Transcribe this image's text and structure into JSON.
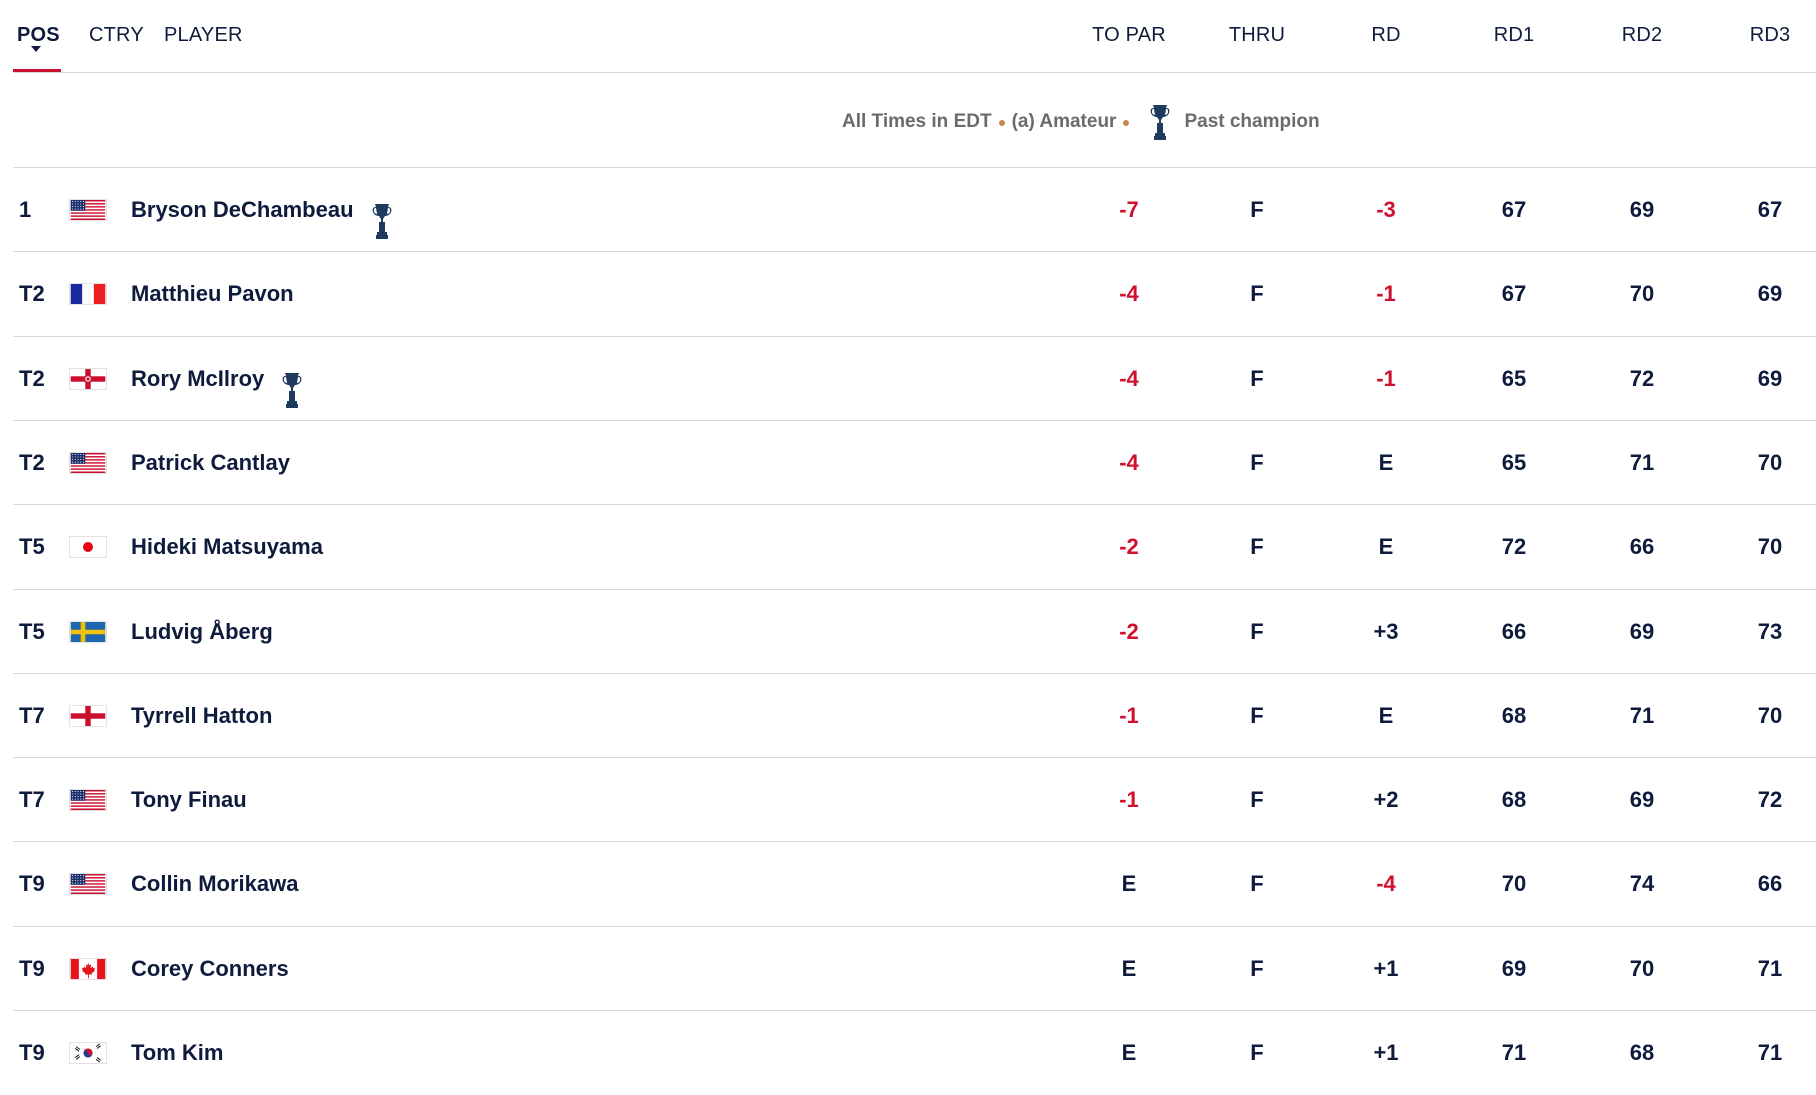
{
  "header": {
    "pos": "POS",
    "ctry": "CTRY",
    "player": "PLAYER",
    "to_par": "TO PAR",
    "thru": "THRU",
    "rd": "RD",
    "rd1": "RD1",
    "rd2": "RD2",
    "rd3": "RD3"
  },
  "legend": {
    "times": "All Times in EDT",
    "amateur": "(a) Amateur",
    "past_champion": "Past champion"
  },
  "colors": {
    "red": "#d0102c",
    "navy": "#0e1b3d",
    "accent": "#c8102e"
  },
  "rows": [
    {
      "pos": "1",
      "flag": "flag-usa",
      "name": "Bryson DeChambeau",
      "past_champion": true,
      "to_par": "-7",
      "thru": "F",
      "rd": "-3",
      "rd1": "67",
      "rd2": "69",
      "rd3": "67"
    },
    {
      "pos": "T2",
      "flag": "flag-france",
      "name": "Matthieu Pavon",
      "past_champion": false,
      "to_par": "-4",
      "thru": "F",
      "rd": "-1",
      "rd1": "67",
      "rd2": "70",
      "rd3": "69"
    },
    {
      "pos": "T2",
      "flag": "flag-northern-ireland",
      "name": "Rory McIlroy",
      "past_champion": true,
      "to_par": "-4",
      "thru": "F",
      "rd": "-1",
      "rd1": "65",
      "rd2": "72",
      "rd3": "69"
    },
    {
      "pos": "T2",
      "flag": "flag-usa",
      "name": "Patrick Cantlay",
      "past_champion": false,
      "to_par": "-4",
      "thru": "F",
      "rd": "E",
      "rd1": "65",
      "rd2": "71",
      "rd3": "70"
    },
    {
      "pos": "T5",
      "flag": "flag-japan",
      "name": "Hideki Matsuyama",
      "past_champion": false,
      "to_par": "-2",
      "thru": "F",
      "rd": "E",
      "rd1": "72",
      "rd2": "66",
      "rd3": "70"
    },
    {
      "pos": "T5",
      "flag": "flag-sweden",
      "name": "Ludvig Åberg",
      "past_champion": false,
      "to_par": "-2",
      "thru": "F",
      "rd": "+3",
      "rd1": "66",
      "rd2": "69",
      "rd3": "73"
    },
    {
      "pos": "T7",
      "flag": "flag-england",
      "name": "Tyrrell Hatton",
      "past_champion": false,
      "to_par": "-1",
      "thru": "F",
      "rd": "E",
      "rd1": "68",
      "rd2": "71",
      "rd3": "70"
    },
    {
      "pos": "T7",
      "flag": "flag-usa",
      "name": "Tony Finau",
      "past_champion": false,
      "to_par": "-1",
      "thru": "F",
      "rd": "+2",
      "rd1": "68",
      "rd2": "69",
      "rd3": "72"
    },
    {
      "pos": "T9",
      "flag": "flag-usa",
      "name": "Collin Morikawa",
      "past_champion": false,
      "to_par": "E",
      "thru": "F",
      "rd": "-4",
      "rd1": "70",
      "rd2": "74",
      "rd3": "66"
    },
    {
      "pos": "T9",
      "flag": "flag-canada",
      "name": "Corey Conners",
      "past_champion": false,
      "to_par": "E",
      "thru": "F",
      "rd": "+1",
      "rd1": "69",
      "rd2": "70",
      "rd3": "71"
    },
    {
      "pos": "T9",
      "flag": "flag-south-korea",
      "name": "Tom Kim",
      "past_champion": false,
      "to_par": "E",
      "thru": "F",
      "rd": "+1",
      "rd1": "71",
      "rd2": "68",
      "rd3": "71"
    }
  ]
}
